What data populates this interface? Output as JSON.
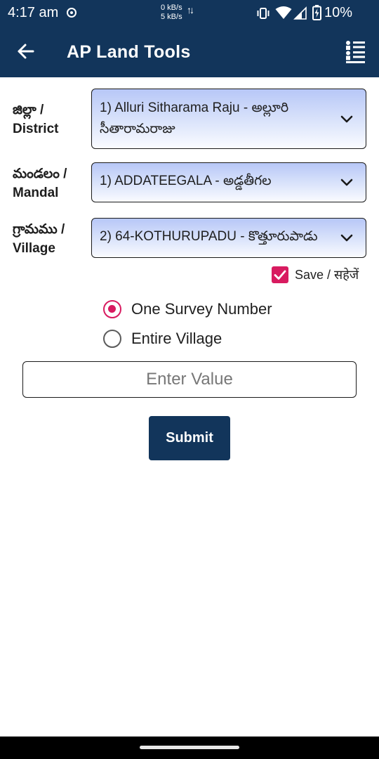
{
  "status_bar": {
    "time": "4:17 am",
    "speed_up": "0 kB/s",
    "speed_down": "5 kB/s",
    "battery": "10%"
  },
  "app_bar": {
    "title": "AP Land Tools"
  },
  "form": {
    "district": {
      "label_te": "జిల్లా /",
      "label_en": "District",
      "value": "1) Alluri Sitharama Raju - అల్లూరి సీతారామరాజు"
    },
    "mandal": {
      "label_te": "మండలం /",
      "label_en": "Mandal",
      "value": "1) ADDATEEGALA - అడ్డతీగల"
    },
    "village": {
      "label_te": "గ్రామము /",
      "label_en": "Village",
      "value": "2) 64-KOTHURUPADU - కొత్తూరుపాడు"
    },
    "save": {
      "label": "Save / सहेजें",
      "checked": true
    },
    "options": [
      {
        "label": "One Survey Number",
        "selected": true
      },
      {
        "label": "Entire Village",
        "selected": false
      }
    ],
    "input": {
      "placeholder": "Enter Value",
      "value": ""
    },
    "submit_label": "Submit"
  },
  "colors": {
    "primary": "#12355b",
    "accent": "#d81b60",
    "select_gradient_top": "#b7c7f7"
  },
  "icons": {
    "back": "arrow-left-icon",
    "menu": "list-menu-icon",
    "dropdown": "chevron-down-icon",
    "save": "checkbox-checked-icon"
  }
}
